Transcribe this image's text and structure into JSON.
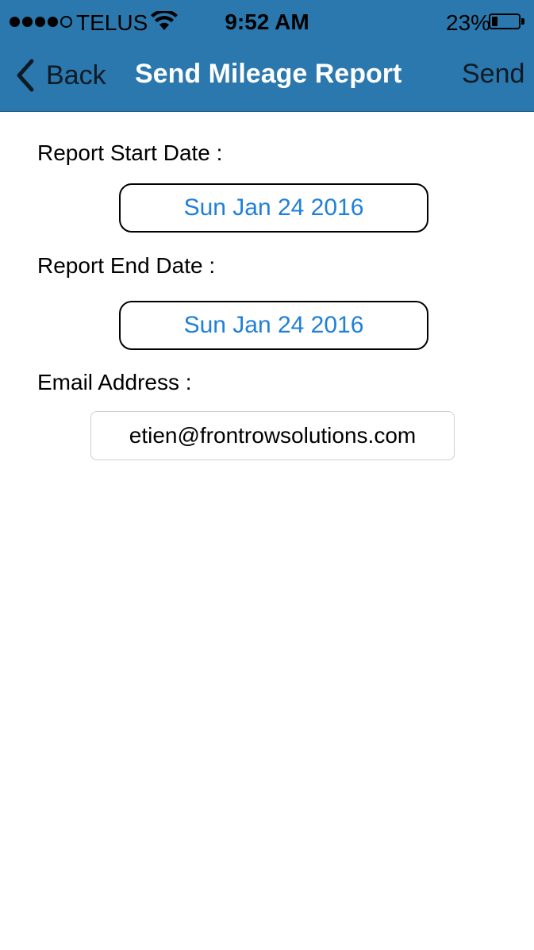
{
  "status_bar": {
    "carrier": "TELUS",
    "time": "9:52 AM",
    "battery_percent": "23%",
    "battery_level": 0.23,
    "signal_bars_filled": 4,
    "signal_bars_total": 5
  },
  "nav": {
    "back_label": "Back",
    "title": "Send Mileage Report",
    "send_label": "Send",
    "bar_color": "#2a78ad"
  },
  "form": {
    "start_label": "Report Start Date :",
    "start_value": "Sun Jan 24 2016",
    "end_label": "Report End Date :",
    "end_value": "Sun Jan 24 2016",
    "email_label": "Email Address :",
    "email_value": "etien@frontrowsolutions.com",
    "date_color": "#1f7fd9"
  },
  "icons": {
    "back": "chevron-left-icon",
    "wifi": "wifi-icon",
    "battery": "battery-icon"
  }
}
